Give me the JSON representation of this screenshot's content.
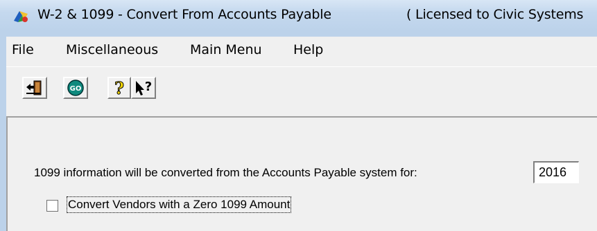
{
  "window": {
    "title": "W-2 & 1099 - Convert From Accounts Payable",
    "license": "( Licensed to Civic Systems"
  },
  "menu": {
    "items": [
      "File",
      "Miscellaneous",
      "Main Menu",
      "Help"
    ]
  },
  "toolbar": {
    "buttons": [
      {
        "icon": "exit-door-icon"
      },
      {
        "icon": "go-icon",
        "label": "GO"
      },
      {
        "icon": "help-question-icon",
        "label": "?"
      },
      {
        "icon": "whats-this-help-icon",
        "label": "?"
      }
    ]
  },
  "form": {
    "prompt": "1099 information will be converted from the Accounts Payable system for:",
    "year_value": "2016",
    "checkbox_label": "Convert Vendors with a Zero 1099 Amount",
    "checkbox_checked": false
  },
  "colors": {
    "title_bar": "#c4d8ee",
    "panel": "#f0f0f0",
    "go_button": "#0f8a7e"
  }
}
